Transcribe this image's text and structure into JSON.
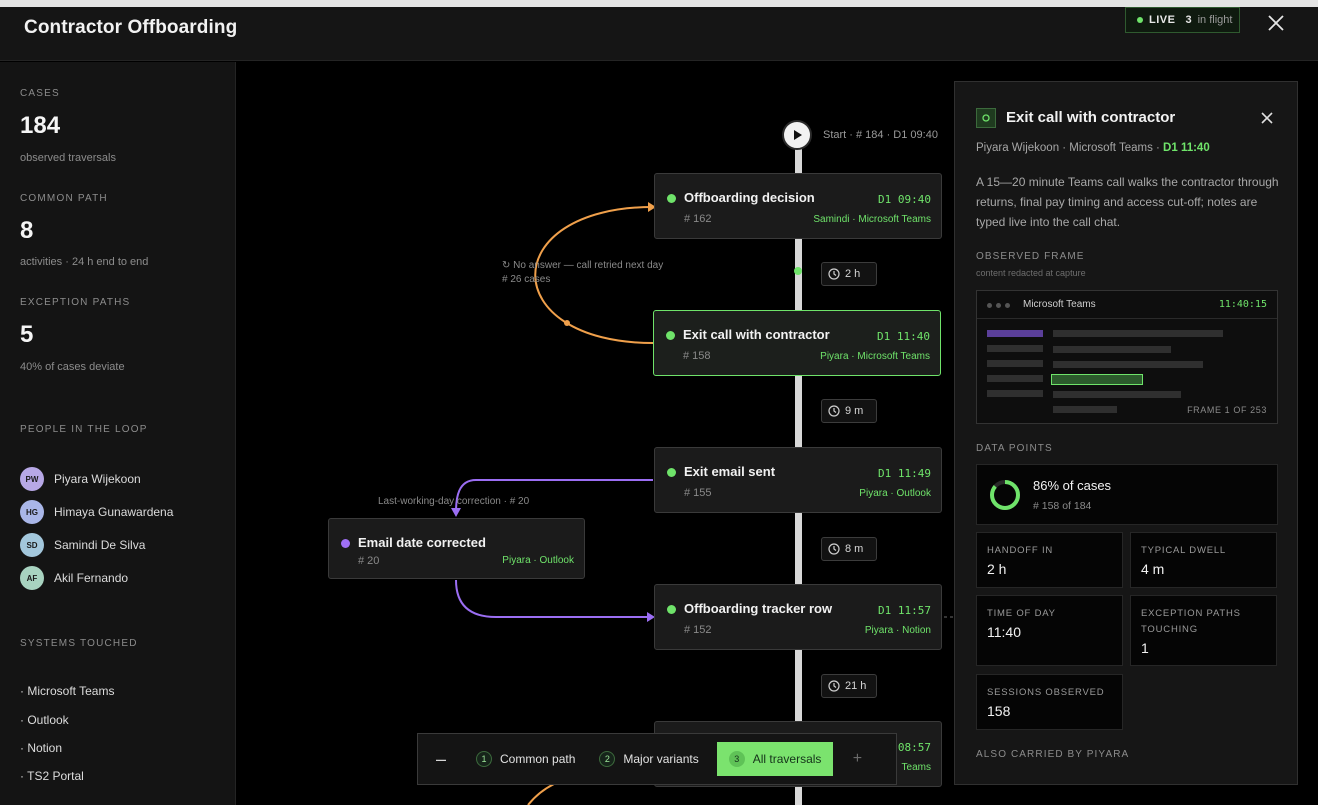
{
  "app": {
    "title": "Contractor Offboarding"
  },
  "live": {
    "label": "LIVE",
    "count": "3",
    "suffix": "in flight"
  },
  "sidebar": {
    "cases": {
      "label": "CASES",
      "value": "184",
      "sub": "observed traversals"
    },
    "common_path": {
      "label": "COMMON PATH",
      "value": "8",
      "sub": "activities · 24 h end to end"
    },
    "exception_paths": {
      "label": "EXCEPTION PATHS",
      "value": "5",
      "sub": "40% of cases deviate"
    },
    "people_label": "PEOPLE IN THE LOOP",
    "people": [
      {
        "initials": "PW",
        "name": "Piyara Wijekoon",
        "color": "#b7a8e6"
      },
      {
        "initials": "HG",
        "name": "Himaya Gunawardena",
        "color": "#a9b6e8"
      },
      {
        "initials": "SD",
        "name": "Samindi De Silva",
        "color": "#a3c7dc"
      },
      {
        "initials": "AF",
        "name": "Akil Fernando",
        "color": "#a8d3c0"
      }
    ],
    "systems_label": "SYSTEMS TOUCHED",
    "systems": [
      "· Microsoft Teams",
      "· Outlook",
      "· Notion",
      "· TS2 Portal"
    ]
  },
  "flow": {
    "start_label": "Start · # 184 · D1 09:40",
    "nodes": [
      {
        "title": "Offboarding decision",
        "count": "# 162",
        "time": "D1 09:40",
        "meta": "Samindi · Microsoft Teams"
      },
      {
        "title": "Exit call with contractor",
        "count": "# 158",
        "time": "D1 11:40",
        "meta": "Piyara · Microsoft Teams"
      },
      {
        "title": "Exit email sent",
        "count": "# 155",
        "time": "D1 11:49",
        "meta": "Piyara · Outlook"
      },
      {
        "title": "Offboarding tracker row",
        "count": "# 152",
        "time": "D1 11:57",
        "meta": "Piyara · Notion"
      },
      {
        "title": "",
        "count": "",
        "time": "08:57",
        "meta": "Teams"
      }
    ],
    "side_node": {
      "title": "Email date corrected",
      "count": "# 20",
      "meta": "Piyara · Outlook"
    },
    "durations": [
      "2 h",
      "9 m",
      "8 m",
      "21 h"
    ],
    "retry_note": {
      "line1": "No answer — call retried next day",
      "line2": "# 26 cases"
    },
    "correction_note": "Last-working-day correction · # 20",
    "colors": {
      "accent": "#6fe36a",
      "retry": "#f0a04b",
      "correction": "#9b6ef3"
    }
  },
  "variants": {
    "options": [
      {
        "num": "1",
        "label": "Common path"
      },
      {
        "num": "2",
        "label": "Major variants"
      },
      {
        "num": "3",
        "label": "All traversals"
      }
    ],
    "selected": 2
  },
  "panel": {
    "title": "Exit call with contractor",
    "subtitle": "Piyara Wijekoon · Microsoft Teams · ",
    "subtitle_time": "D1 11:40",
    "description": "A 15—20 minute Teams call walks the contractor through returns, final pay timing and access cut-off; notes are typed live into the call chat.",
    "frame_label": "OBSERVED FRAME",
    "frame_note": "content redacted at capture",
    "frame": {
      "app": "Microsoft Teams",
      "time": "11:40:15",
      "count": "FRAME 1 OF 253"
    },
    "data_label": "DATA POINTS",
    "share": {
      "pct": "86% of cases",
      "sub": "# 158 of 184",
      "fraction": 0.86
    },
    "cells": [
      {
        "label": "HANDOFF IN",
        "value": "2 h"
      },
      {
        "label": "TYPICAL DWELL",
        "value": "4 m"
      },
      {
        "label": "TIME OF DAY",
        "value": "11:40"
      },
      {
        "label": "EXCEPTION PATHS TOUCHING",
        "value": "1"
      },
      {
        "label": "SESSIONS OBSERVED",
        "value": "158"
      }
    ],
    "also_label": "ALSO CARRIED BY PIYARA"
  }
}
